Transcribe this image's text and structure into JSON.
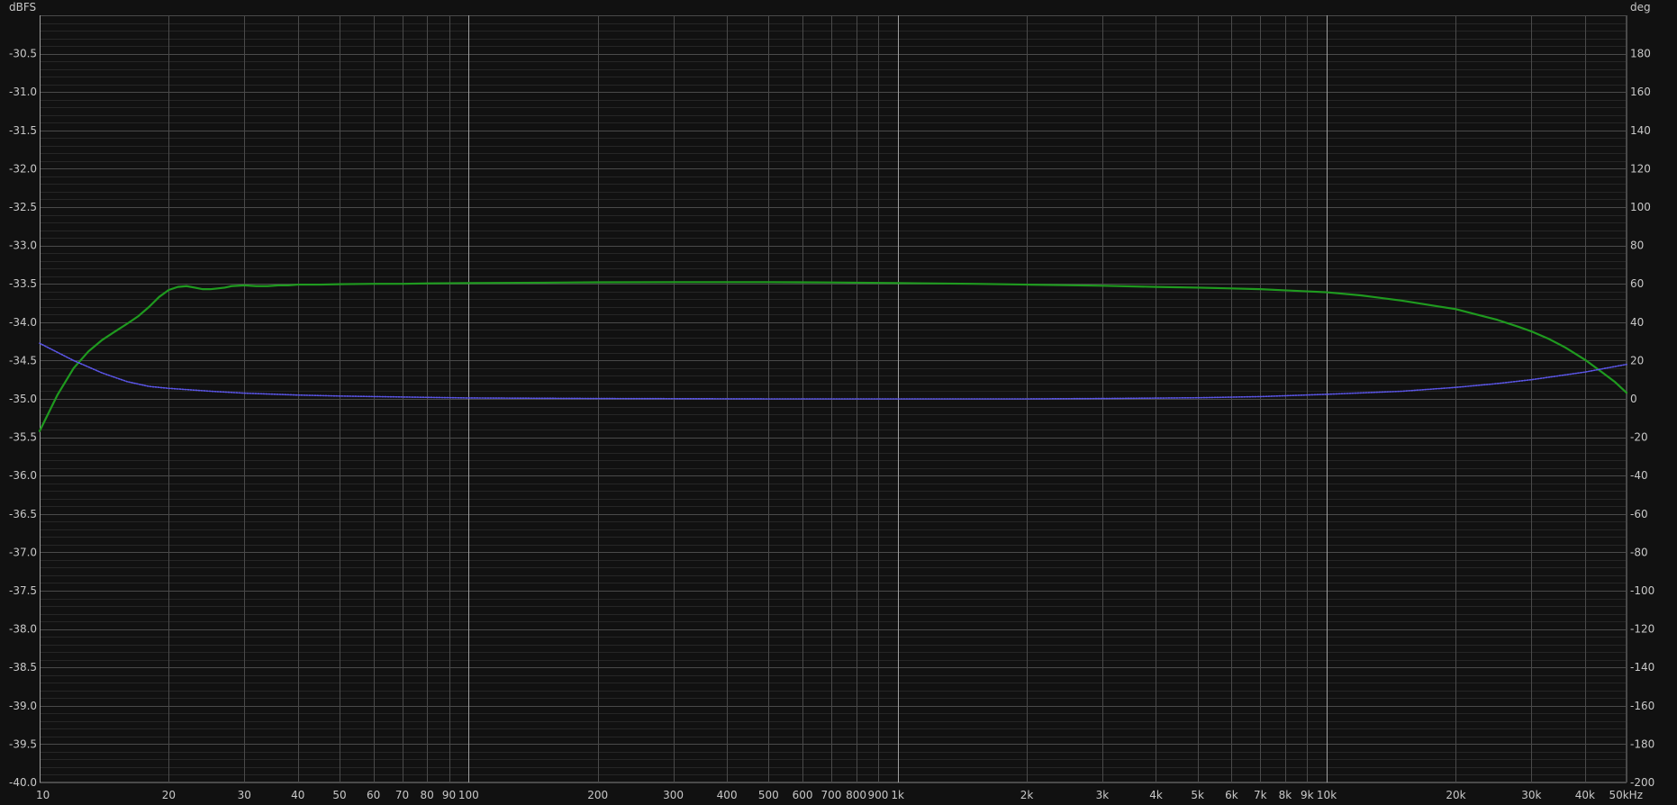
{
  "chart_data": {
    "type": "line",
    "x_scale": "log",
    "xlim": [
      10,
      50000
    ],
    "ylim_left": [
      -40.0,
      -30.0
    ],
    "ylim_right": [
      -200,
      200
    ],
    "left_unit": "dBFS",
    "right_unit": "deg",
    "x_unit_suffix": "kHz",
    "grid": true,
    "colors": {
      "background": "#111111",
      "grid_major": "#4a4a4a",
      "grid_minor": "#262626",
      "grid_decade": "#a0a0a0",
      "text": "#c8c8c8",
      "magnitude": "#1f9a1f",
      "phase": "#5a55e6"
    },
    "x_ticks": [
      {
        "v": 10,
        "label": "10"
      },
      {
        "v": 20,
        "label": "20"
      },
      {
        "v": 30,
        "label": "30"
      },
      {
        "v": 40,
        "label": "40"
      },
      {
        "v": 50,
        "label": "50"
      },
      {
        "v": 60,
        "label": "60"
      },
      {
        "v": 70,
        "label": "70"
      },
      {
        "v": 80,
        "label": "80"
      },
      {
        "v": 90,
        "label": "90"
      },
      {
        "v": 100,
        "label": "100"
      },
      {
        "v": 200,
        "label": "200"
      },
      {
        "v": 300,
        "label": "300"
      },
      {
        "v": 400,
        "label": "400"
      },
      {
        "v": 500,
        "label": "500"
      },
      {
        "v": 600,
        "label": "600"
      },
      {
        "v": 700,
        "label": "700"
      },
      {
        "v": 800,
        "label": "800"
      },
      {
        "v": 900,
        "label": "900"
      },
      {
        "v": 1000,
        "label": "1k"
      },
      {
        "v": 2000,
        "label": "2k"
      },
      {
        "v": 3000,
        "label": "3k"
      },
      {
        "v": 4000,
        "label": "4k"
      },
      {
        "v": 5000,
        "label": "5k"
      },
      {
        "v": 6000,
        "label": "6k"
      },
      {
        "v": 7000,
        "label": "7k"
      },
      {
        "v": 8000,
        "label": "8k"
      },
      {
        "v": 9000,
        "label": "9k"
      },
      {
        "v": 10000,
        "label": "10k"
      },
      {
        "v": 20000,
        "label": "20k"
      },
      {
        "v": 30000,
        "label": "30k"
      },
      {
        "v": 40000,
        "label": "40k"
      },
      {
        "v": 50000,
        "label": "50kHz"
      }
    ],
    "y_left_ticks": [
      -30.5,
      -31.0,
      -31.5,
      -32.0,
      -32.5,
      -33.0,
      -33.5,
      -34.0,
      -34.5,
      -35.0,
      -35.5,
      -36.0,
      -36.5,
      -37.0,
      -37.5,
      -38.0,
      -38.5,
      -39.0,
      -39.5,
      -40.0
    ],
    "y_left_tick_labels": [
      "-30.5",
      "-31.0",
      "-31.5",
      "-32.0",
      "-32.5",
      "-33.0",
      "-33.5",
      "-34.0",
      "-34.5",
      "-35.0",
      "-35.5",
      "-36.0",
      "-36.5",
      "-37.0",
      "-37.5",
      "-38.0",
      "-38.5",
      "-39.0",
      "-39.5",
      "-40.0"
    ],
    "y_right_ticks": [
      180,
      160,
      140,
      120,
      100,
      80,
      60,
      40,
      20,
      0,
      -20,
      -40,
      -60,
      -80,
      -100,
      -120,
      -140,
      -160,
      -180,
      -200
    ],
    "y_right_tick_labels": [
      "180",
      "160",
      "140",
      "120",
      "100",
      "80",
      "60",
      "40",
      "20",
      "0",
      "-20",
      "-40",
      "-60",
      "-80",
      "-100",
      "-120",
      "-140",
      "-160",
      "-180",
      "-200"
    ],
    "series": [
      {
        "axis": "left",
        "style": "solid",
        "x": [
          10,
          11,
          12,
          13,
          14,
          15,
          16,
          17,
          18,
          19,
          20,
          21,
          22,
          23,
          24,
          25,
          26,
          27,
          28,
          30,
          32,
          34,
          36,
          38,
          40,
          45,
          50,
          60,
          70,
          80,
          100,
          150,
          200,
          300,
          500,
          700,
          1000,
          1500,
          2000,
          3000,
          4000,
          5000,
          6000,
          7000,
          8000,
          10000,
          12000,
          15000,
          18000,
          20000,
          22000,
          25000,
          28000,
          30000,
          33000,
          36000,
          40000,
          44000,
          47000,
          50000
        ],
        "values": [
          -35.42,
          -34.95,
          -34.6,
          -34.38,
          -34.23,
          -34.12,
          -34.02,
          -33.92,
          -33.8,
          -33.67,
          -33.58,
          -33.54,
          -33.53,
          -33.55,
          -33.57,
          -33.57,
          -33.56,
          -33.55,
          -33.53,
          -33.52,
          -33.53,
          -33.53,
          -33.52,
          -33.52,
          -33.51,
          -33.51,
          -33.505,
          -33.5,
          -33.5,
          -33.495,
          -33.49,
          -33.485,
          -33.48,
          -33.478,
          -33.478,
          -33.482,
          -33.49,
          -33.5,
          -33.51,
          -33.525,
          -33.54,
          -33.55,
          -33.56,
          -33.57,
          -33.585,
          -33.61,
          -33.65,
          -33.72,
          -33.79,
          -33.83,
          -33.89,
          -33.97,
          -34.06,
          -34.12,
          -34.22,
          -34.33,
          -34.49,
          -34.66,
          -34.78,
          -34.92
        ]
      },
      {
        "axis": "right",
        "style": "dotted",
        "x": [
          10,
          12,
          14,
          16,
          18,
          20,
          25,
          30,
          40,
          50,
          70,
          100,
          200,
          500,
          1000,
          2000,
          3000,
          5000,
          7000,
          10000,
          15000,
          20000,
          25000,
          30000,
          40000,
          50000
        ],
        "values": [
          29,
          20,
          13.5,
          9,
          6.5,
          5.5,
          4,
          3,
          2,
          1.5,
          1,
          0.5,
          0.2,
          0,
          0,
          0,
          0.2,
          0.6,
          1.2,
          2.4,
          4,
          6,
          8,
          10,
          14,
          18
        ]
      }
    ]
  }
}
